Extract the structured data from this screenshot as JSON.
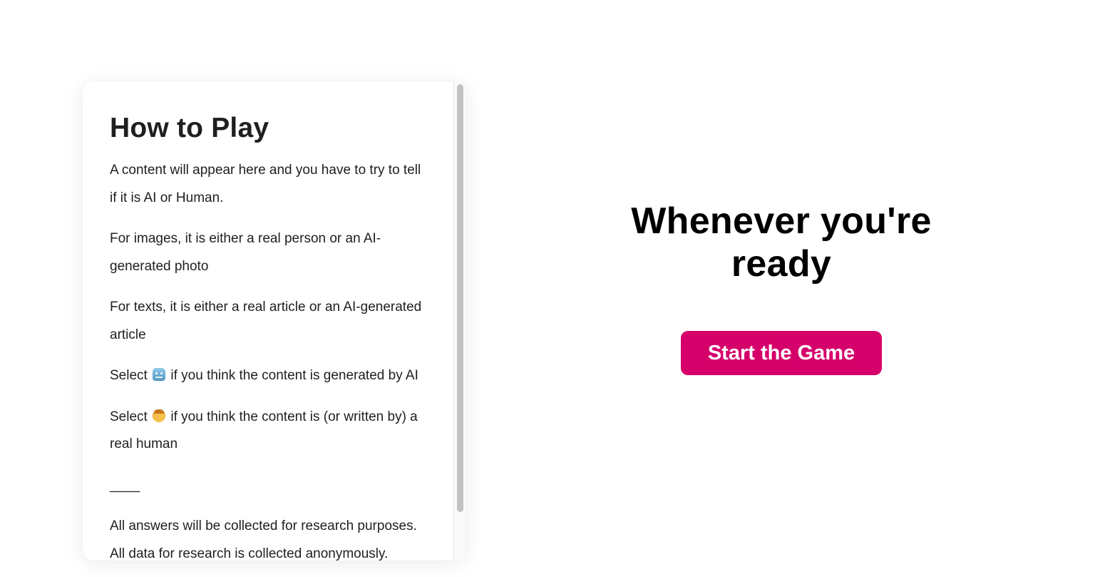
{
  "instructions": {
    "title": "How to Play",
    "p1": "A content will appear here and you have to try to tell if it is AI or Human.",
    "p2": "For images, it is either a real person or an AI-generated photo",
    "p3": "For texts, it is either a real article or an AI-generated article",
    "p4_prefix": "Select",
    "p4_icon": "robot-icon",
    "p4_suffix": "if you think the content is generated by AI",
    "p5_prefix": "Select",
    "p5_icon": "person-icon",
    "p5_suffix": "if you think the content is (or written by) a real human",
    "divider": "____",
    "p6": "All answers will be collected for research purposes. All data for research is collected anonymously."
  },
  "main": {
    "heading": "Whenever you're ready",
    "start_button_label": "Start the Game",
    "accent_color": "#d6006b"
  }
}
